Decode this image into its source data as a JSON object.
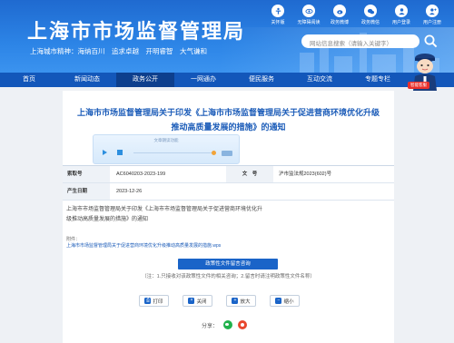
{
  "header": {
    "site_title": "上海市市场监督管理局",
    "slogan": "上海城市精神：海纳百川　追求卓越　开明睿智　大气谦和",
    "search_placeholder": "网站信息搜索（请输入关键字）",
    "top_icons": [
      {
        "label": "关怀版",
        "icon": "accessibility-icon"
      },
      {
        "label": "无障碍阅读",
        "icon": "eye-icon"
      },
      {
        "label": "政务微博",
        "icon": "weibo-icon"
      },
      {
        "label": "政务微信",
        "icon": "wechat-icon"
      },
      {
        "label": "用户登录",
        "icon": "user-icon"
      },
      {
        "label": "用户注册",
        "icon": "register-icon"
      }
    ],
    "mascot_badge": "智能客服"
  },
  "nav": {
    "items": [
      "首页",
      "新闻动态",
      "政务公开",
      "一网通办",
      "便民服务",
      "互动交流",
      "专题专栏"
    ],
    "active_index": 2
  },
  "article": {
    "title_line1": "上海市市场监督管理局关于印发《上海市市场监督管理局关于促进营商环境优化升级",
    "title_line2": "推动高质量发展的措施》的通知",
    "player_label": "文章朗读功能",
    "info": {
      "index_label": "索取号",
      "index_value": "AC6040203-2023-199",
      "docno_label": "文　号",
      "docno_value": "沪市监法规2023(602)号",
      "date_label": "产生日期",
      "date_value": "2023-12-26"
    },
    "body_line1": "上海市市场监督管理局关于印发《上海市市场监督管理局关于促进营商环境优化升",
    "body_line2": "级推动高质量发展的措施》的通知",
    "attachment_label": "附件：",
    "attachment_file": "上海市市场监督管理局关于促进营商环境优化升级推动高质量发展的措施.wps",
    "consult_button": "政策性文件留言咨询",
    "note": "（注：1.只接收对该政策性文件的相关咨询；2.留言时请注明政策性文件名称）",
    "actions": {
      "print": "打印",
      "close": "关闭",
      "zoom_in": "放大",
      "zoom_out": "缩小"
    },
    "share_label": "分享："
  }
}
